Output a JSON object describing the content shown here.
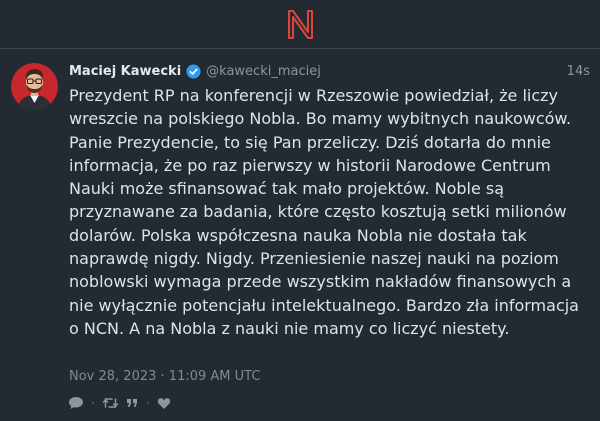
{
  "app": {
    "logo": "n-logo-icon",
    "accent": "#e0453c"
  },
  "post": {
    "author_name": "Maciej Kawecki",
    "handle": "@kawecki_maciej",
    "verified_icon": "verified-badge-icon",
    "time_ago": "14s",
    "body": "Prezydent RP na konferencji w Rzeszowie powiedział, że liczy wreszcie na polskiego Nobla. Bo mamy wybitnych naukowców. Panie Prezydencie, to się Pan przeliczy. Dziś dotarła do mnie informacja, że po raz pierwszy w historii Narodowe Centrum Nauki może sfinansować tak mało projektów. Noble są przyznawane za badania, które często kosztują setki milionów dolarów. Polska współczesna nauka Nobla nie dostała tak naprawdę nigdy. Nigdy. Przeniesienie naszej nauki na poziom noblowski wymaga przede wszystkim nakładów finansowych a nie wyłącznie potencjału intelektualnego. Bardzo zła informacja o NCN. A na Nobla z nauki nie mamy co liczyć niestety.",
    "date": "Nov 28, 2023 · 11:09 AM UTC"
  },
  "actions": {
    "reply_icon": "comment-icon",
    "retweet_icon": "retweet-icon",
    "quote_icon": "quote-icon",
    "like_icon": "heart-icon",
    "separator": "·"
  }
}
